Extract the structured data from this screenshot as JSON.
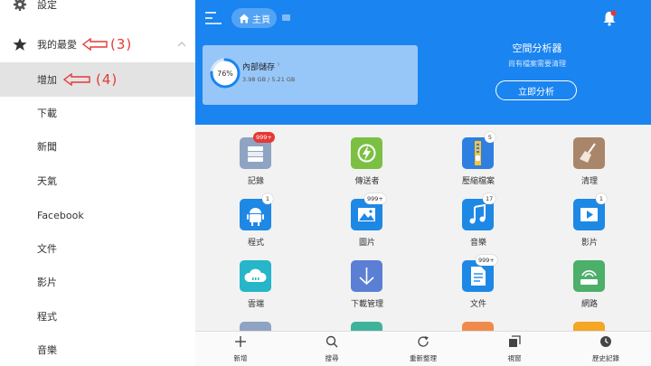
{
  "sidebar": {
    "settings": "設定",
    "favorites": "我的最愛",
    "add": "增加",
    "items": [
      "下載",
      "新聞",
      "天氣",
      "Facebook",
      "文件",
      "影片",
      "程式",
      "音樂"
    ],
    "annotation_3": "(3)",
    "annotation_4": "(4)"
  },
  "header": {
    "home": "主頁",
    "storage_title": "內部儲存",
    "storage_percent": "76%",
    "storage_percent_value": 76,
    "storage_size": "3.98 GB / 5.21 GB",
    "analyzer_title": "空間分析器",
    "analyzer_subtitle": "尚有檔案需要清理",
    "analyze_button": "立即分析"
  },
  "grid": {
    "records": "記錄",
    "records_badge": "999+",
    "sender": "傳送者",
    "archive": "壓縮檔案",
    "archive_badge": "5",
    "clean": "清理",
    "apps": "程式",
    "apps_badge": "1",
    "images": "圖片",
    "images_badge": "999+",
    "music": "音樂",
    "music_badge": "17",
    "video": "影片",
    "video_badge": "1",
    "cloud": "雲端",
    "download_manager": "下載管理",
    "documents": "文件",
    "documents_badge": "999+",
    "network": "網路"
  },
  "bottombar": {
    "new": "新增",
    "search": "搜尋",
    "refresh": "重新整理",
    "windows": "視窗",
    "history": "歷史記錄"
  },
  "colors": {
    "header_blue": "#1a84f0",
    "annotation_red": "#e53935"
  }
}
